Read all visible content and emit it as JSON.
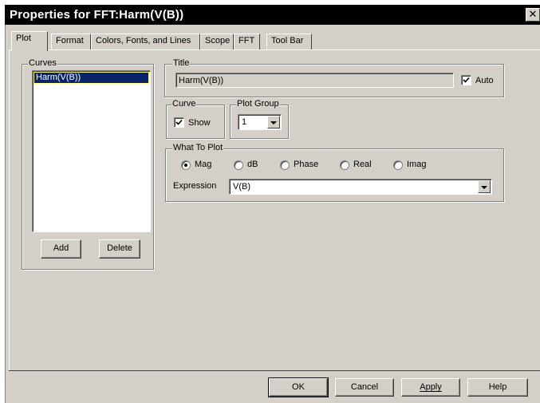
{
  "window": {
    "title": "Properties for FFT:Harm(V(B))",
    "close_glyph": "✕"
  },
  "tabs": [
    {
      "label": "Plot",
      "active": true
    },
    {
      "label": "Format"
    },
    {
      "label": "Colors, Fonts, and Lines"
    },
    {
      "label": "Scope"
    },
    {
      "label": "FFT"
    },
    {
      "label": "Tool Bar"
    }
  ],
  "curves": {
    "group_label": "Curves",
    "items": [
      {
        "label": "Harm(V(B))",
        "selected": true
      }
    ],
    "add_label": "Add",
    "delete_label": "Delete"
  },
  "title_group": {
    "group_label": "Title",
    "value": "Harm(V(B))",
    "auto_label": "Auto",
    "auto_checked": true
  },
  "curve_group": {
    "group_label": "Curve",
    "show_label": "Show",
    "show_checked": true
  },
  "plot_group": {
    "group_label": "Plot Group",
    "value": "1"
  },
  "what_to_plot": {
    "group_label": "What To Plot",
    "options": [
      {
        "label": "Mag",
        "selected": true
      },
      {
        "label": "dB",
        "selected": false
      },
      {
        "label": "Phase",
        "selected": false
      },
      {
        "label": "Real",
        "selected": false
      },
      {
        "label": "Imag",
        "selected": false
      }
    ],
    "expression_label": "Expression",
    "expression_value": "V(B)"
  },
  "footer": {
    "ok_label": "OK",
    "cancel_label": "Cancel",
    "apply_label": "Apply",
    "help_label": "Help"
  },
  "icons": {
    "check": "check-icon",
    "dropdown": "chevron-down-icon",
    "close": "close-icon"
  },
  "colors": {
    "dialog_face": "#d4d0c8",
    "title_bar": "#000000",
    "selection": "#0a246a"
  }
}
